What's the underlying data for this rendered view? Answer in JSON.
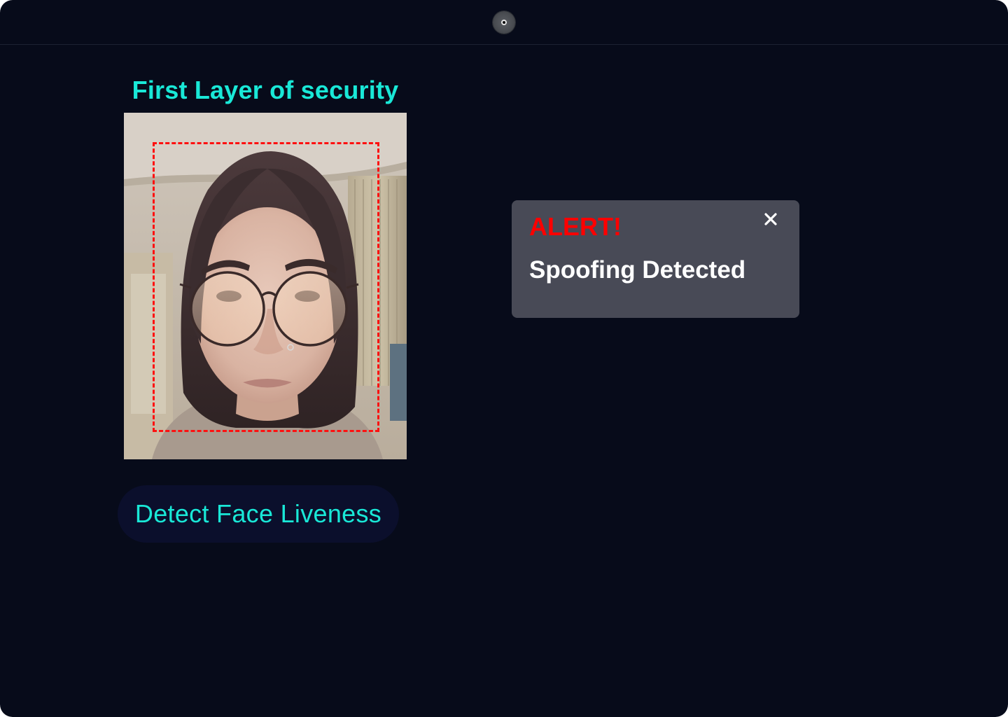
{
  "header": {
    "camera_icon": "webcam-icon"
  },
  "main": {
    "title": "First Layer of security",
    "video": {
      "face_detection_box_color": "#ff1010"
    },
    "detect_button_label": "Detect Face Liveness"
  },
  "alert": {
    "title": "ALERT!",
    "message": "Spoofing Detected",
    "close_icon": "close-icon"
  },
  "colors": {
    "background": "#070b1a",
    "accent": "#19e8d7",
    "alert_title": "#ff0000",
    "alert_background": "#484a56",
    "button_background": "#0b0f2c"
  }
}
